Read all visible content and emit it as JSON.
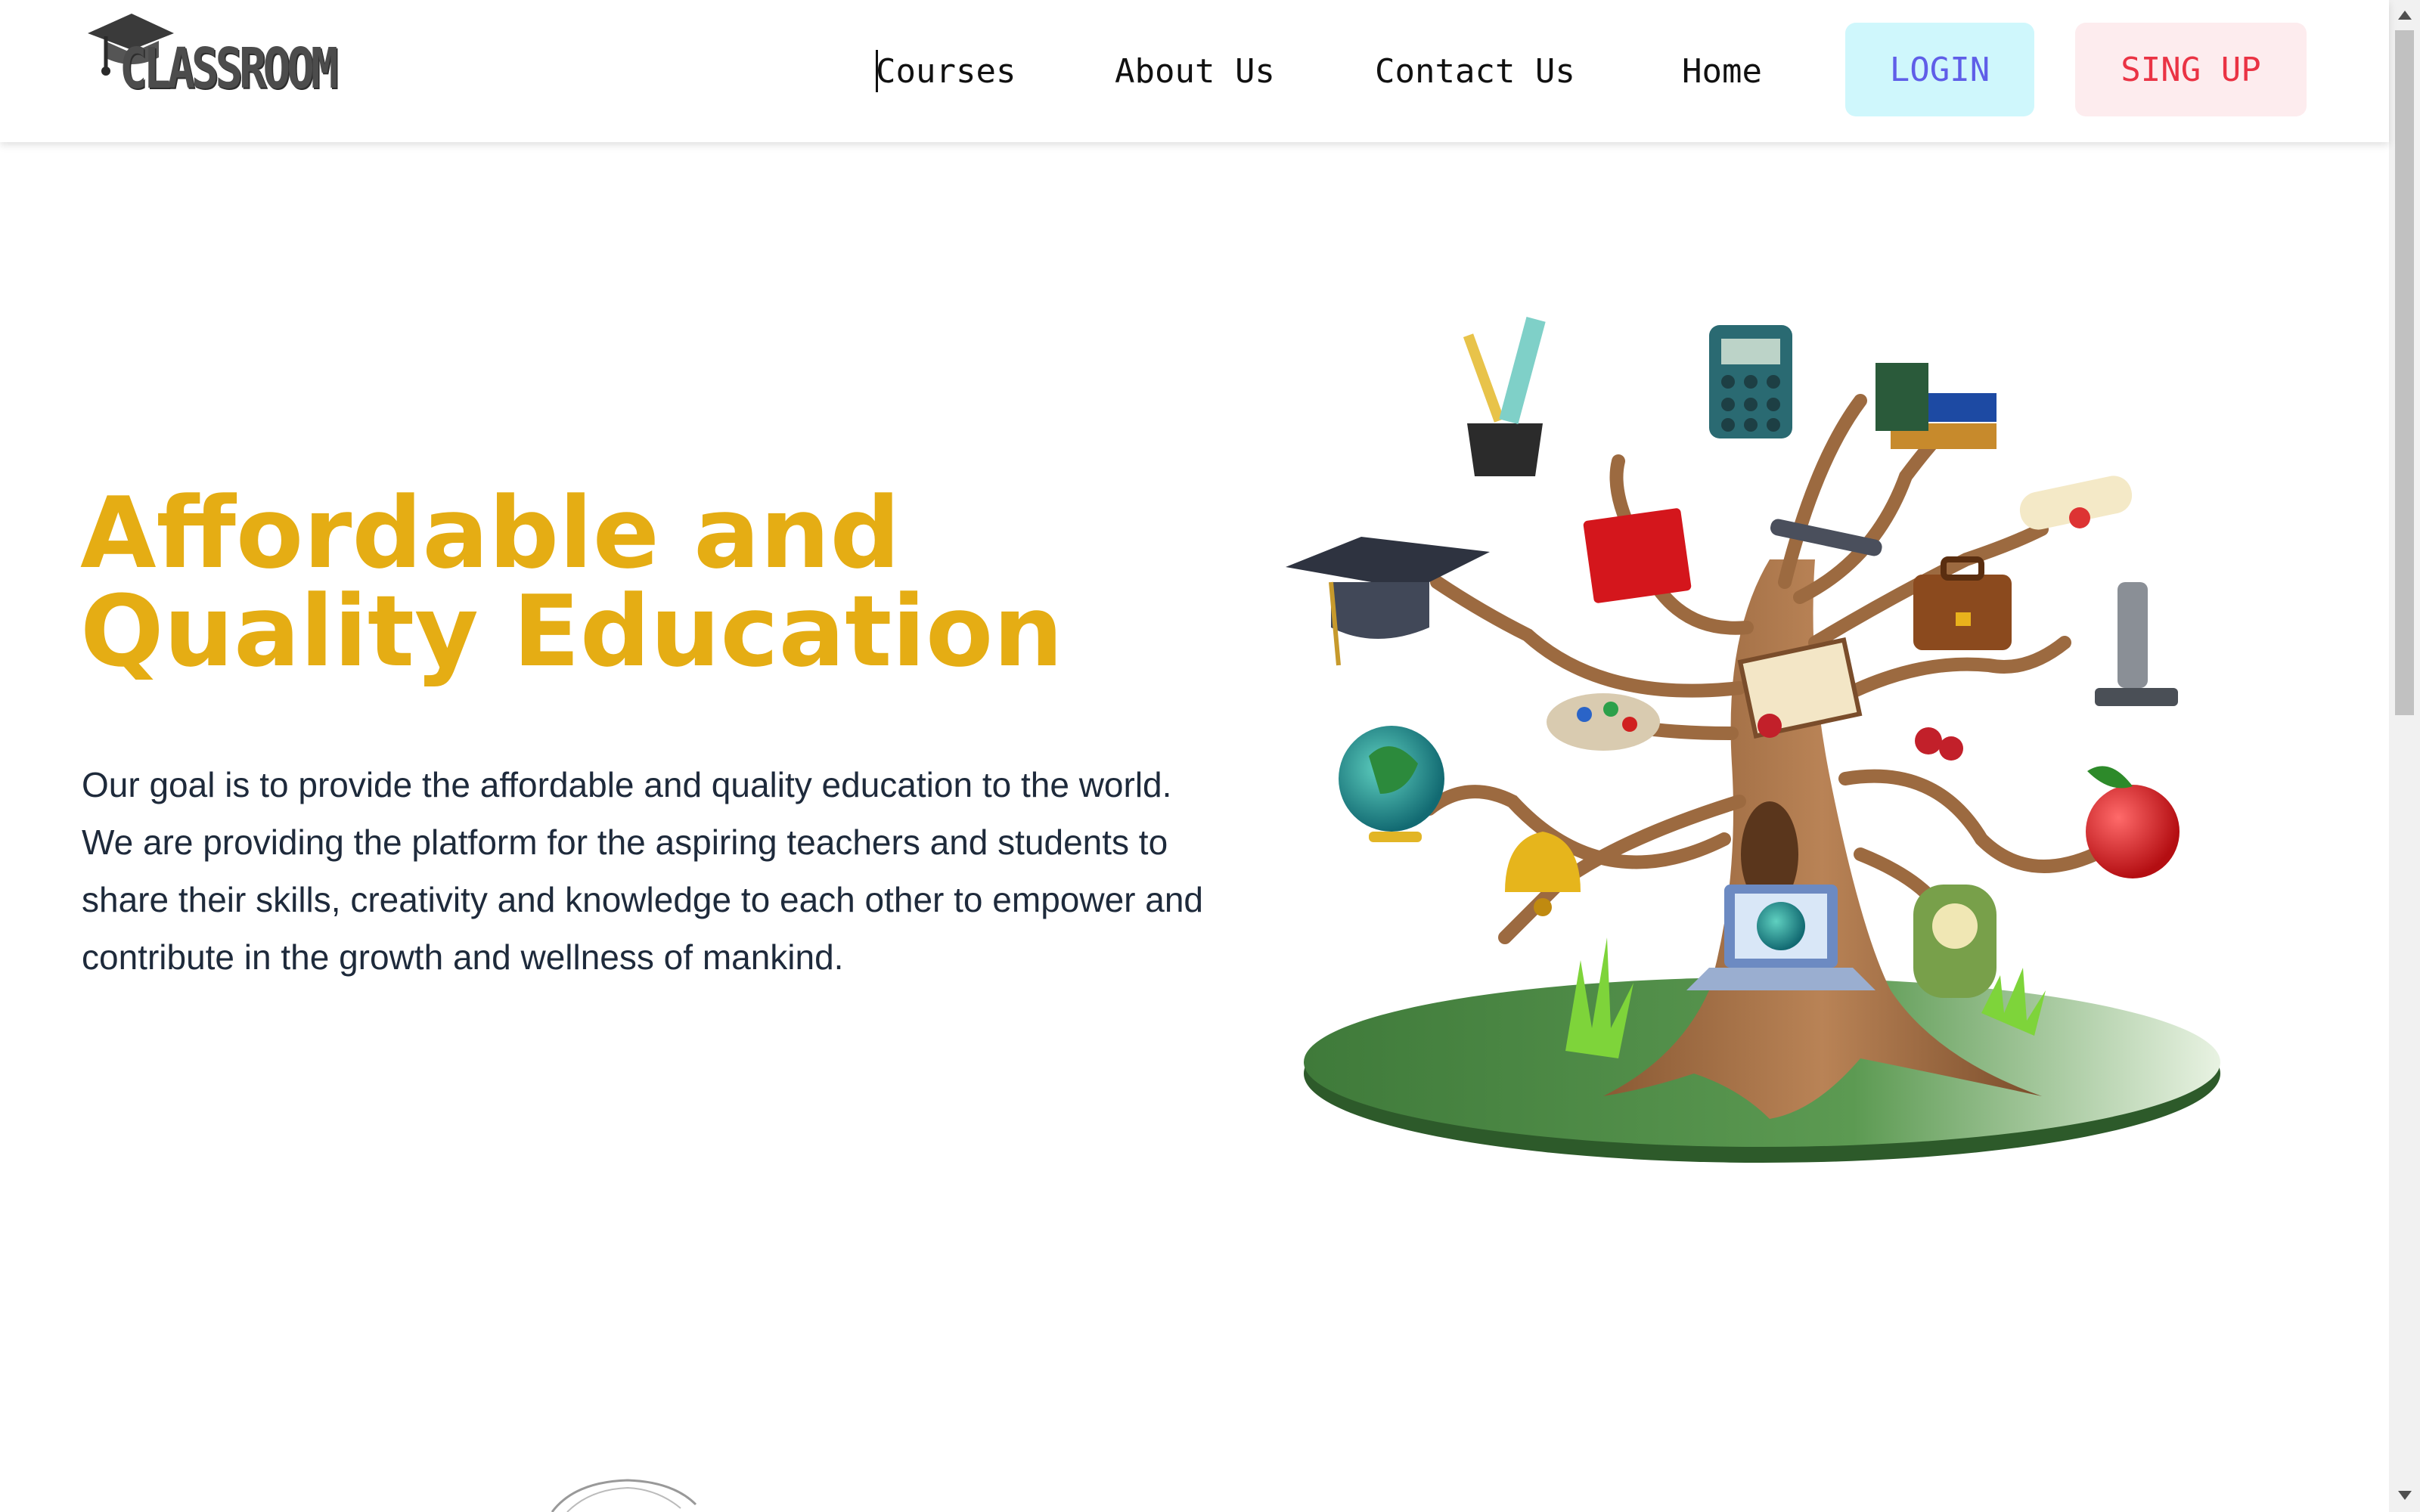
{
  "brand": {
    "logo_text": "CLASSROOM"
  },
  "nav": {
    "links": [
      "Courses",
      "About Us",
      "Contact Us",
      "Home"
    ],
    "login_label": "LOGIN",
    "signup_label": "SING UP"
  },
  "hero": {
    "title": "Affordable and Quality Education",
    "description": "Our goal is to provide the affordable and quality education to the world. We are providing the platform for the aspiring teachers and students to share their skills, creativity and knowledge to each other to empower and contribute in the growth and wellness of mankind."
  },
  "colors": {
    "title": "#e5ad14",
    "login_bg": "#cff7fc",
    "login_text": "#5f5ee8",
    "signup_bg": "#fdecee",
    "signup_text": "#ea3344"
  }
}
